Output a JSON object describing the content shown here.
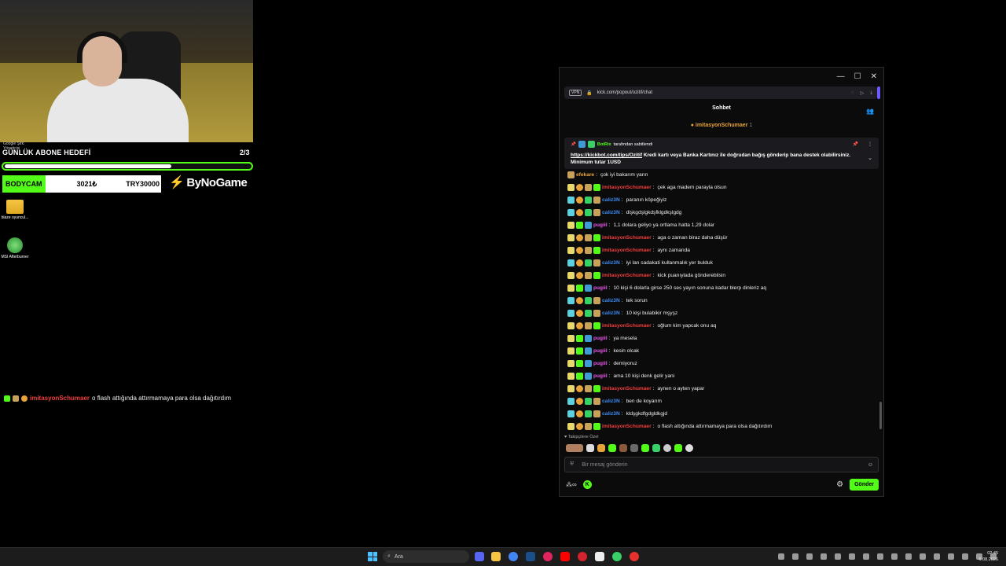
{
  "overlay": {
    "tiny_label_1": "Google Şirk.",
    "tiny_label_2": "Yöneticisi",
    "goal_title": "GÜNLÜK ABONE HEDEFİ",
    "goal_count": "2/3",
    "goal_progress": 0.67,
    "donate_label": "BODYCAM",
    "donate_amount": "3021₺",
    "donate_target": "TRY30000",
    "sponsor_name": "ByNoGame",
    "chat_user": "imitasyonSchumaer",
    "chat_text": "o flash attığında attırmamaya para olsa dağıtırdım"
  },
  "desktop": {
    "folder_label": "blaze oyuncul...",
    "msi_label": "MSI Afterburner"
  },
  "browser": {
    "url": "kick.com/popout/ozitif/chat",
    "vpn": "VPN",
    "minimize": "—",
    "maximize": "☐",
    "close": "✕"
  },
  "chat": {
    "header": "Sohbet",
    "top_gifter": "imitasyonSchumaer",
    "top_gifter_count": "1",
    "pinned": {
      "by": "BotRix",
      "by_suffix": "tarafından sabitlendi",
      "link": "https://kickbot.com/tips/Ozitif",
      "text": " Kredi kartı veya Banka Kartınız ile doğrudan bağış gönderip bana destek olabilirsiniz. Minimum tutar 1USD"
    },
    "messages": [
      {
        "user": "efekare",
        "color": "orange",
        "badges": [
          "gift"
        ],
        "text": "çok iyi bakarım yarın"
      },
      {
        "user": "imitasyonSchumaer",
        "color": "red",
        "badges": [
          "sub",
          "coin",
          "gift",
          "vip"
        ],
        "text": "çek aga madem parayla olsun"
      },
      {
        "user": "caliz3N",
        "color": "blue",
        "badges": [
          "og",
          "coin",
          "green",
          "gift"
        ],
        "text": "paranın köpeğiyiz"
      },
      {
        "user": "caliz3N",
        "color": "blue",
        "badges": [
          "og",
          "coin",
          "green",
          "gift"
        ],
        "text": "dişkgdşlgkdşfklgdkşlgdg"
      },
      {
        "user": "pugiil",
        "color": "pink",
        "badges": [
          "sub",
          "vip",
          "blue"
        ],
        "text": "1,1 dolara geliyo ya ortlama hatta 1,29 dolar"
      },
      {
        "user": "imitasyonSchumaer",
        "color": "red",
        "badges": [
          "sub",
          "coin",
          "gift",
          "vip"
        ],
        "text": "aga o zaman biraz daha düşür"
      },
      {
        "user": "imitasyonSchumaer",
        "color": "red",
        "badges": [
          "sub",
          "coin",
          "gift",
          "vip"
        ],
        "text": "aynı zamanda"
      },
      {
        "user": "caliz3N",
        "color": "blue",
        "badges": [
          "og",
          "coin",
          "green",
          "gift"
        ],
        "text": "iyi lan sadakati kullanmalık yer bulduk"
      },
      {
        "user": "imitasyonSchumaer",
        "color": "red",
        "badges": [
          "sub",
          "coin",
          "gift",
          "vip"
        ],
        "text": "kick puanıylada gönderebilsin"
      },
      {
        "user": "pugiil",
        "color": "pink",
        "badges": [
          "sub",
          "vip",
          "blue"
        ],
        "text": "10 kişi 6 dolarla girse 250 ses yayın sonuna kadar blerp dinleriz aq"
      },
      {
        "user": "caliz3N",
        "color": "blue",
        "badges": [
          "og",
          "coin",
          "green",
          "gift"
        ],
        "text": "tek sorun"
      },
      {
        "user": "caliz3N",
        "color": "blue",
        "badges": [
          "og",
          "coin",
          "green",
          "gift"
        ],
        "text": "10 kişi bulabikir mşyşz"
      },
      {
        "user": "imitasyonSchumaer",
        "color": "red",
        "badges": [
          "sub",
          "coin",
          "gift",
          "vip"
        ],
        "text": "oğlum kim yapcak onu aq"
      },
      {
        "user": "pugiil",
        "color": "pink",
        "badges": [
          "sub",
          "vip",
          "blue"
        ],
        "text": "ya mesela"
      },
      {
        "user": "pugiil",
        "color": "pink",
        "badges": [
          "sub",
          "vip",
          "blue"
        ],
        "text": "kesin olcak"
      },
      {
        "user": "pugiil",
        "color": "pink",
        "badges": [
          "sub",
          "vip",
          "blue"
        ],
        "text": "demiyoruz"
      },
      {
        "user": "pugiil",
        "color": "pink",
        "badges": [
          "sub",
          "vip",
          "blue"
        ],
        "text": "ama 10 kişi denk gelir yani"
      },
      {
        "user": "imitasyonSchumaer",
        "color": "red",
        "badges": [
          "sub",
          "coin",
          "gift",
          "vip"
        ],
        "text": "aynen o ayten yapar"
      },
      {
        "user": "caliz3N",
        "color": "blue",
        "badges": [
          "og",
          "coin",
          "green",
          "gift"
        ],
        "text": "ben de koyarım"
      },
      {
        "user": "caliz3N",
        "color": "blue",
        "badges": [
          "og",
          "coin",
          "green",
          "gift"
        ],
        "text": "kldşgkdfgdgldkgjd"
      },
      {
        "user": "imitasyonSchumaer",
        "color": "red",
        "badges": [
          "sub",
          "coin",
          "gift",
          "vip"
        ],
        "text": "o flash attığında attırmamaya para olsa dağıtırdım"
      }
    ],
    "followers_label": "Takipçilere Özel",
    "input_placeholder": "Bir mesaj gönderin",
    "send_label": "Gönder"
  },
  "taskbar": {
    "search_placeholder": "Ara",
    "time": "02:45",
    "date": "6.08.2026"
  },
  "colors": {
    "kick_green": "#53fc18",
    "red_user": "#f03e3e",
    "blue_user": "#3e8bf0",
    "pink_user": "#e85ae8"
  }
}
